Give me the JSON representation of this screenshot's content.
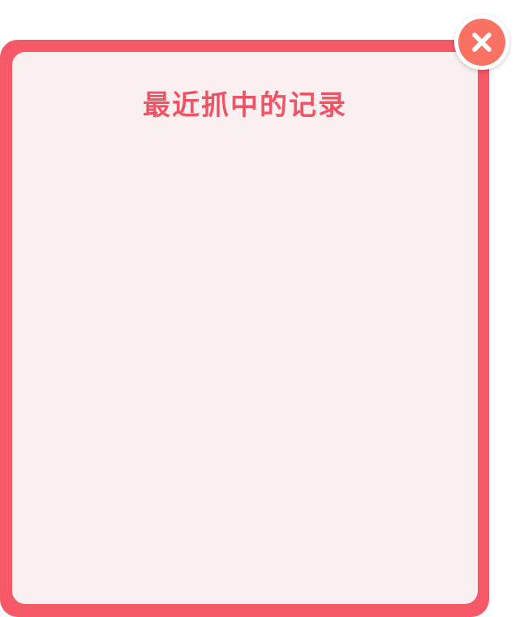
{
  "modal": {
    "title": "最近抓中的记录",
    "records": []
  },
  "close_button": {
    "icon": "close-icon"
  },
  "colors": {
    "frame": "#F55866",
    "panel": "#FAF0F2",
    "title": "#F05464",
    "close_fill": "#FA7263"
  }
}
